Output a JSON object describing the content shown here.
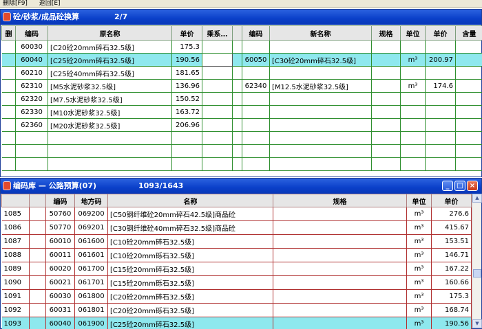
{
  "menu": {
    "delete": "删除[F9]",
    "back": "返回[E]"
  },
  "upper": {
    "title": "砼/砂浆/成品砼换算",
    "count": "2/7",
    "columns": [
      "删",
      "编码",
      "原名称",
      "单价",
      "乘系…",
      "",
      "编码",
      "新名称",
      "规格",
      "单位",
      "单价",
      "含量"
    ],
    "rows": [
      {
        "del": "",
        "code": "60030",
        "name": "[C20砼20mm碎石32.5级]",
        "price": "175.3",
        "mult": "",
        "x": "",
        "newcode": "",
        "newname": "",
        "spec": "",
        "unit": "",
        "newprice": "",
        "qty": ""
      },
      {
        "del": "",
        "code": "60040",
        "name": "[C25砼20mm碎石32.5级]",
        "price": "190.56",
        "mult": "",
        "x": "",
        "newcode": "60050",
        "newname": "[C30砼20mm碎石32.5级]",
        "spec": "",
        "unit": "m³",
        "newprice": "200.97",
        "qty": ""
      },
      {
        "del": "",
        "code": "60210",
        "name": "[C25砼40mm碎石32.5级]",
        "price": "181.65",
        "mult": "",
        "x": "",
        "newcode": "",
        "newname": "",
        "spec": "",
        "unit": "",
        "newprice": "",
        "qty": ""
      },
      {
        "del": "",
        "code": "62310",
        "name": "[M5水泥砂浆32.5级]",
        "price": "136.96",
        "mult": "",
        "x": "",
        "newcode": "62340",
        "newname": "[M12.5水泥砂浆32.5级]",
        "spec": "",
        "unit": "m³",
        "newprice": "174.6",
        "qty": ""
      },
      {
        "del": "",
        "code": "62320",
        "name": "[M7.5水泥砂浆32.5级]",
        "price": "150.52",
        "mult": "",
        "x": "",
        "newcode": "",
        "newname": "",
        "spec": "",
        "unit": "",
        "newprice": "",
        "qty": ""
      },
      {
        "del": "",
        "code": "62330",
        "name": "[M10水泥砂浆32.5级]",
        "price": "163.72",
        "mult": "",
        "x": "",
        "newcode": "",
        "newname": "",
        "spec": "",
        "unit": "",
        "newprice": "",
        "qty": ""
      },
      {
        "del": "",
        "code": "62360",
        "name": "[M20水泥砂浆32.5级]",
        "price": "206.96",
        "mult": "",
        "x": "",
        "newcode": "",
        "newname": "",
        "spec": "",
        "unit": "",
        "newprice": "",
        "qty": ""
      }
    ]
  },
  "lower": {
    "title": "编码库 — 公路预算(07)",
    "count": "1093/1643",
    "controls": {
      "minimize": "_",
      "maximize": "□",
      "close": "×"
    },
    "columns": [
      "",
      "",
      "编码",
      "地方码",
      "名称",
      "规格",
      "单位",
      "单价"
    ],
    "rows": [
      {
        "no": "1085",
        "mark": "",
        "code": "50760",
        "local": "069200",
        "name": "[C50钢纤维砼20mm碎石42.5级]商品砼",
        "spec": "",
        "unit": "m³",
        "price": "276.6"
      },
      {
        "no": "1086",
        "mark": "",
        "code": "50770",
        "local": "069201",
        "name": "[C30钢纤维砼40mm碎石32.5级]商品砼",
        "spec": "",
        "unit": "m³",
        "price": "415.67"
      },
      {
        "no": "1087",
        "mark": "",
        "code": "60010",
        "local": "061600",
        "name": "[C10砼20mm碎石32.5级]",
        "spec": "",
        "unit": "m³",
        "price": "153.51"
      },
      {
        "no": "1088",
        "mark": "",
        "code": "60011",
        "local": "061601",
        "name": "[C10砼20mm砾石32.5级]",
        "spec": "",
        "unit": "m³",
        "price": "146.71"
      },
      {
        "no": "1089",
        "mark": "",
        "code": "60020",
        "local": "061700",
        "name": "[C15砼20mm碎石32.5级]",
        "spec": "",
        "unit": "m³",
        "price": "167.22"
      },
      {
        "no": "1090",
        "mark": "",
        "code": "60021",
        "local": "061701",
        "name": "[C15砼20mm砾石32.5级]",
        "spec": "",
        "unit": "m³",
        "price": "160.66"
      },
      {
        "no": "1091",
        "mark": "",
        "code": "60030",
        "local": "061800",
        "name": "[C20砼20mm碎石32.5级]",
        "spec": "",
        "unit": "m³",
        "price": "175.3"
      },
      {
        "no": "1092",
        "mark": "",
        "code": "60031",
        "local": "061801",
        "name": "[C20砼20mm砾石32.5级]",
        "spec": "",
        "unit": "m³",
        "price": "168.74"
      },
      {
        "no": "1093",
        "mark": "",
        "code": "60040",
        "local": "061900",
        "name": "[C25砼20mm碎石32.5级]",
        "spec": "",
        "unit": "m³",
        "price": "190.56"
      }
    ]
  }
}
